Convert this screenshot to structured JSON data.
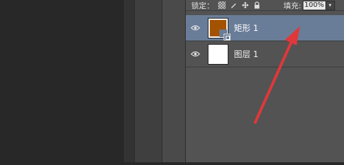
{
  "lock_bar": {
    "label": "锁定：",
    "fill_label": "填充:",
    "fill_value": "100%",
    "icons": [
      "lock-transparent-pixels-icon",
      "lock-image-pixels-icon",
      "lock-position-icon",
      "lock-all-icon"
    ]
  },
  "layers": [
    {
      "name": "矩形 1",
      "type": "shape",
      "selected": true,
      "visible": true,
      "fill_color": "#a35300"
    },
    {
      "name": "图层 1",
      "type": "raster",
      "selected": false,
      "visible": true
    }
  ],
  "colors": {
    "panel_bg": "#535353",
    "selected_row": "#6a7d98",
    "annotation_arrow": "#e0383a"
  }
}
